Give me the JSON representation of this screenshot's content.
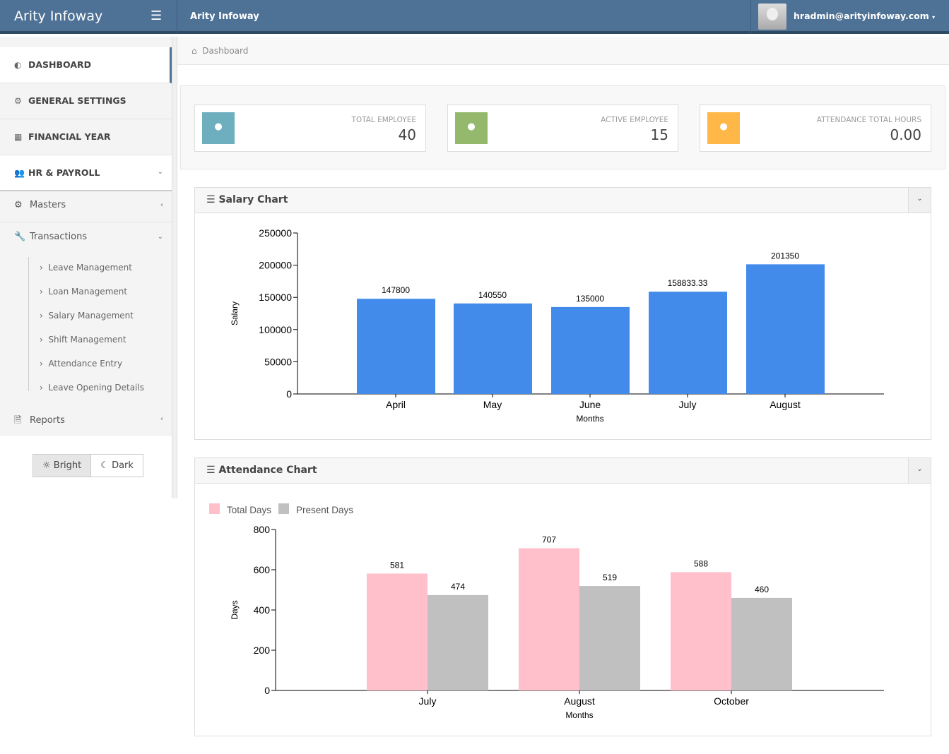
{
  "header": {
    "brand": "Arity Infoway",
    "title": "Arity Infoway",
    "user_email": "hradmin@arityinfoway.com"
  },
  "sidebar": {
    "top_items": [
      {
        "label": "DASHBOARD",
        "icon": "dashboard-icon"
      },
      {
        "label": "GENERAL SETTINGS",
        "icon": "cogs-icon"
      },
      {
        "label": "FINANCIAL YEAR",
        "icon": "calendar-icon"
      },
      {
        "label": "HR & PAYROLL",
        "icon": "users-icon"
      }
    ],
    "sub_items": [
      {
        "label": "Masters",
        "icon": "cogs-icon"
      },
      {
        "label": "Transactions",
        "icon": "wrench-icon"
      },
      {
        "label": "Reports",
        "icon": "file-icon"
      }
    ],
    "transactions": [
      "Leave Management",
      "Loan Management",
      "Salary Management",
      "Shift Management",
      "Attendance Entry",
      "Leave Opening Details"
    ],
    "theme": {
      "bright": "Bright",
      "dark": "Dark",
      "selected": "Bright"
    }
  },
  "breadcrumb": "Dashboard",
  "stats": [
    {
      "label": "TOTAL EMPLOYEE",
      "value": "40",
      "color": "#6daebf"
    },
    {
      "label": "ACTIVE EMPLOYEE",
      "value": "15",
      "color": "#95b96c"
    },
    {
      "label": "ATTENDANCE TOTAL HOURS",
      "value": "0.00",
      "color": "#ffb848"
    }
  ],
  "panels": {
    "salary": "Salary Chart",
    "attendance": "Attendance Chart"
  },
  "chart_data": [
    {
      "type": "bar",
      "title": "",
      "xlabel": "Months",
      "ylabel": "Salary",
      "ylim": [
        0,
        250000
      ],
      "yticks": [
        0,
        50000,
        100000,
        150000,
        200000,
        250000
      ],
      "categories": [
        "April",
        "May",
        "June",
        "July",
        "August"
      ],
      "values": [
        147800,
        140550,
        135000,
        158833.33,
        201350
      ],
      "labels": [
        "147800",
        "140550",
        "135000",
        "158833.33",
        "201350"
      ],
      "color": "#428bea"
    },
    {
      "type": "bar",
      "title": "",
      "xlabel": "Months",
      "ylabel": "Days",
      "ylim": [
        0,
        800
      ],
      "yticks": [
        0,
        200,
        400,
        600,
        800
      ],
      "categories": [
        "July",
        "August",
        "October"
      ],
      "series": [
        {
          "name": "Total Days",
          "values": [
            581,
            707,
            588
          ],
          "color": "#ffc0cb"
        },
        {
          "name": "Present Days",
          "values": [
            474,
            519,
            460
          ],
          "color": "#c0c0c0"
        }
      ]
    }
  ]
}
